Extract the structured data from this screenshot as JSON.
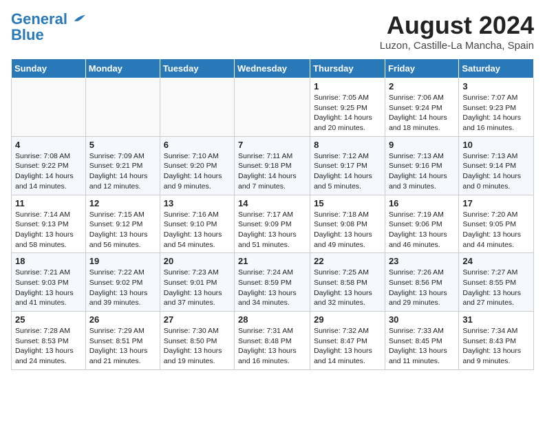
{
  "header": {
    "logo_line1": "General",
    "logo_line2": "Blue",
    "month_year": "August 2024",
    "location": "Luzon, Castille-La Mancha, Spain"
  },
  "weekdays": [
    "Sunday",
    "Monday",
    "Tuesday",
    "Wednesday",
    "Thursday",
    "Friday",
    "Saturday"
  ],
  "weeks": [
    [
      {
        "day": "",
        "content": ""
      },
      {
        "day": "",
        "content": ""
      },
      {
        "day": "",
        "content": ""
      },
      {
        "day": "",
        "content": ""
      },
      {
        "day": "1",
        "content": "Sunrise: 7:05 AM\nSunset: 9:25 PM\nDaylight: 14 hours\nand 20 minutes."
      },
      {
        "day": "2",
        "content": "Sunrise: 7:06 AM\nSunset: 9:24 PM\nDaylight: 14 hours\nand 18 minutes."
      },
      {
        "day": "3",
        "content": "Sunrise: 7:07 AM\nSunset: 9:23 PM\nDaylight: 14 hours\nand 16 minutes."
      }
    ],
    [
      {
        "day": "4",
        "content": "Sunrise: 7:08 AM\nSunset: 9:22 PM\nDaylight: 14 hours\nand 14 minutes."
      },
      {
        "day": "5",
        "content": "Sunrise: 7:09 AM\nSunset: 9:21 PM\nDaylight: 14 hours\nand 12 minutes."
      },
      {
        "day": "6",
        "content": "Sunrise: 7:10 AM\nSunset: 9:20 PM\nDaylight: 14 hours\nand 9 minutes."
      },
      {
        "day": "7",
        "content": "Sunrise: 7:11 AM\nSunset: 9:18 PM\nDaylight: 14 hours\nand 7 minutes."
      },
      {
        "day": "8",
        "content": "Sunrise: 7:12 AM\nSunset: 9:17 PM\nDaylight: 14 hours\nand 5 minutes."
      },
      {
        "day": "9",
        "content": "Sunrise: 7:13 AM\nSunset: 9:16 PM\nDaylight: 14 hours\nand 3 minutes."
      },
      {
        "day": "10",
        "content": "Sunrise: 7:13 AM\nSunset: 9:14 PM\nDaylight: 14 hours\nand 0 minutes."
      }
    ],
    [
      {
        "day": "11",
        "content": "Sunrise: 7:14 AM\nSunset: 9:13 PM\nDaylight: 13 hours\nand 58 minutes."
      },
      {
        "day": "12",
        "content": "Sunrise: 7:15 AM\nSunset: 9:12 PM\nDaylight: 13 hours\nand 56 minutes."
      },
      {
        "day": "13",
        "content": "Sunrise: 7:16 AM\nSunset: 9:10 PM\nDaylight: 13 hours\nand 54 minutes."
      },
      {
        "day": "14",
        "content": "Sunrise: 7:17 AM\nSunset: 9:09 PM\nDaylight: 13 hours\nand 51 minutes."
      },
      {
        "day": "15",
        "content": "Sunrise: 7:18 AM\nSunset: 9:08 PM\nDaylight: 13 hours\nand 49 minutes."
      },
      {
        "day": "16",
        "content": "Sunrise: 7:19 AM\nSunset: 9:06 PM\nDaylight: 13 hours\nand 46 minutes."
      },
      {
        "day": "17",
        "content": "Sunrise: 7:20 AM\nSunset: 9:05 PM\nDaylight: 13 hours\nand 44 minutes."
      }
    ],
    [
      {
        "day": "18",
        "content": "Sunrise: 7:21 AM\nSunset: 9:03 PM\nDaylight: 13 hours\nand 41 minutes."
      },
      {
        "day": "19",
        "content": "Sunrise: 7:22 AM\nSunset: 9:02 PM\nDaylight: 13 hours\nand 39 minutes."
      },
      {
        "day": "20",
        "content": "Sunrise: 7:23 AM\nSunset: 9:01 PM\nDaylight: 13 hours\nand 37 minutes."
      },
      {
        "day": "21",
        "content": "Sunrise: 7:24 AM\nSunset: 8:59 PM\nDaylight: 13 hours\nand 34 minutes."
      },
      {
        "day": "22",
        "content": "Sunrise: 7:25 AM\nSunset: 8:58 PM\nDaylight: 13 hours\nand 32 minutes."
      },
      {
        "day": "23",
        "content": "Sunrise: 7:26 AM\nSunset: 8:56 PM\nDaylight: 13 hours\nand 29 minutes."
      },
      {
        "day": "24",
        "content": "Sunrise: 7:27 AM\nSunset: 8:55 PM\nDaylight: 13 hours\nand 27 minutes."
      }
    ],
    [
      {
        "day": "25",
        "content": "Sunrise: 7:28 AM\nSunset: 8:53 PM\nDaylight: 13 hours\nand 24 minutes."
      },
      {
        "day": "26",
        "content": "Sunrise: 7:29 AM\nSunset: 8:51 PM\nDaylight: 13 hours\nand 21 minutes."
      },
      {
        "day": "27",
        "content": "Sunrise: 7:30 AM\nSunset: 8:50 PM\nDaylight: 13 hours\nand 19 minutes."
      },
      {
        "day": "28",
        "content": "Sunrise: 7:31 AM\nSunset: 8:48 PM\nDaylight: 13 hours\nand 16 minutes."
      },
      {
        "day": "29",
        "content": "Sunrise: 7:32 AM\nSunset: 8:47 PM\nDaylight: 13 hours\nand 14 minutes."
      },
      {
        "day": "30",
        "content": "Sunrise: 7:33 AM\nSunset: 8:45 PM\nDaylight: 13 hours\nand 11 minutes."
      },
      {
        "day": "31",
        "content": "Sunrise: 7:34 AM\nSunset: 8:43 PM\nDaylight: 13 hours\nand 9 minutes."
      }
    ]
  ]
}
